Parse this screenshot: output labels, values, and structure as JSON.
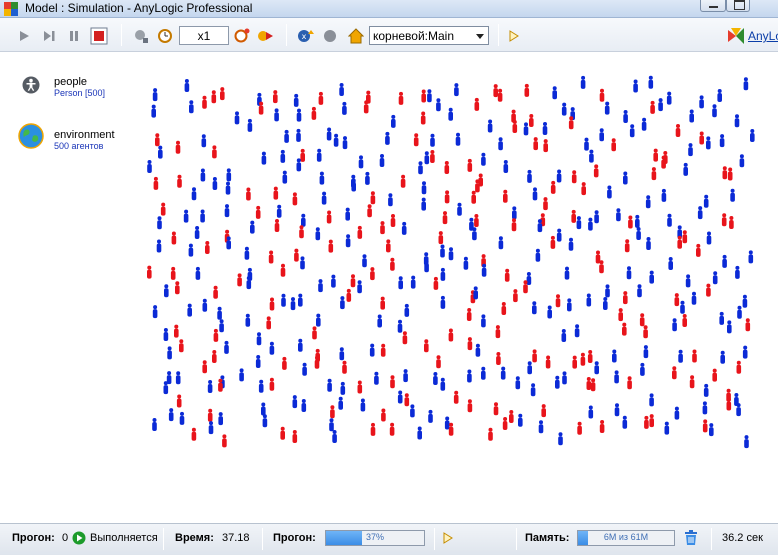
{
  "window": {
    "title": "Model : Simulation - AnyLogic Professional"
  },
  "toolbar": {
    "speed_value": "x1",
    "view_selector": "корневой:Main",
    "brand": "AnyLogic"
  },
  "agents_panel": {
    "items": [
      {
        "name": "people",
        "detail": "Person [500]",
        "icon": "person-icon"
      },
      {
        "name": "environment",
        "detail": "500 агентов",
        "icon": "globe-icon"
      }
    ]
  },
  "simulation": {
    "agent_colors": {
      "red": "#e8141b",
      "blue": "#0b2ad6"
    },
    "grid": {
      "columns": 26,
      "rows": 18
    }
  },
  "status": {
    "run_label": "Прогон:",
    "run_number": "0",
    "run_state": "Выполняется",
    "time_label": "Время:",
    "time_value": "37.18",
    "progress_label": "Прогон:",
    "progress_text": "37%",
    "progress_fraction": 0.37,
    "memory_label": "Память:",
    "memory_text": "6M из 61M",
    "memory_fraction": 0.1,
    "elapsed": "36.2 сек"
  },
  "colors": {
    "play_green": "#1c9b2b",
    "stop_red": "#d32020",
    "accent_blue": "#3b8de6"
  }
}
